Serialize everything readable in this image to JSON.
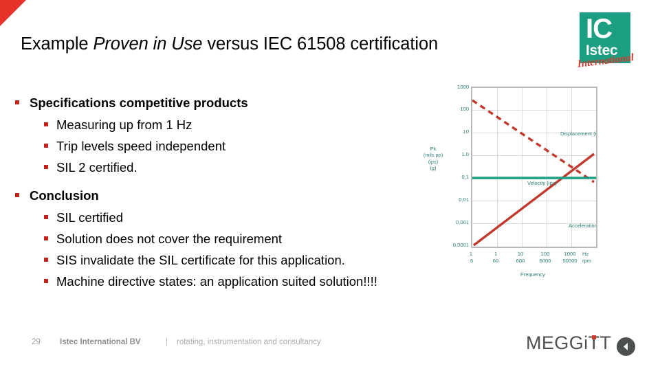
{
  "slide": {
    "title_part1": "Example ",
    "title_emphasis": "Proven in Use",
    "title_part2": " versus IEC 61508 certification",
    "accent_red": "#e8332a",
    "bullet_red": "#c0251c",
    "logo_teal": "#1b9e82",
    "chart_teal": "#2a7d76"
  },
  "logo": {
    "ic": "IC",
    "istec": "Istec",
    "international": "International"
  },
  "content": {
    "blocks": [
      {
        "heading": "Specifications competitive products",
        "items": [
          "Measuring up from 1 Hz",
          "Trip levels speed independent",
          "SIL 2 certified."
        ]
      },
      {
        "heading": "Conclusion",
        "items": [
          "SIL certified",
          "Solution does not cover the requirement",
          "SIS invalidate the SIL certificate for this application.",
          "Machine directive states: an application suited solution!!!!"
        ]
      }
    ]
  },
  "chart_data": {
    "type": "line",
    "title": "",
    "xlabel": "Frequency",
    "ylabel": "Pk\n(mils pp)\n(ips)\n(g)",
    "ylabel_lines": [
      "Pk",
      "(mils pp)",
      "(ips)",
      "(g)"
    ],
    "xlabel_units_hz": "Hz",
    "xlabel_units_rpm": "rpm",
    "xscale": "log",
    "yscale": "log",
    "grid": true,
    "legend": "inline-annotations",
    "yticks": [
      "1000",
      "100",
      "10",
      "1.0",
      "0,1",
      "0,01",
      "0,001",
      "0,0001"
    ],
    "yvalues": [
      1000,
      100,
      10,
      1.0,
      0.1,
      0.01,
      0.001,
      0.0001
    ],
    "xticks_hz": [
      "1",
      "1",
      "10",
      "100",
      "1000"
    ],
    "xticks_rpm": [
      ".6",
      "60",
      "600",
      "6000",
      "50000"
    ],
    "xlim_hz": [
      0.6,
      2000
    ],
    "ylim": [
      0.0001,
      1000
    ],
    "series": [
      {
        "name": "Displacement (mils pp)",
        "color": "#c0392b",
        "style": "dashed",
        "x": [
          1,
          1000
        ],
        "y": [
          400,
          0.03
        ],
        "slope": "-1"
      },
      {
        "name": "Velocity (ips)",
        "color": "#1b9e82",
        "style": "solid",
        "x": [
          1,
          1500
        ],
        "y": [
          0.085,
          0.085
        ],
        "slope": "0"
      },
      {
        "name": "Acceleration (G)",
        "color": "#c0392b",
        "style": "solid",
        "x": [
          1,
          1500
        ],
        "y": [
          0.0001,
          1.2
        ],
        "slope": "+1"
      }
    ]
  },
  "footer": {
    "page_number": "29",
    "company": "Istec International BV",
    "separator": "|",
    "tagline": "rotating, instrumentation and consultancy",
    "brand": "MEGGiTT",
    "back_label": "back"
  }
}
